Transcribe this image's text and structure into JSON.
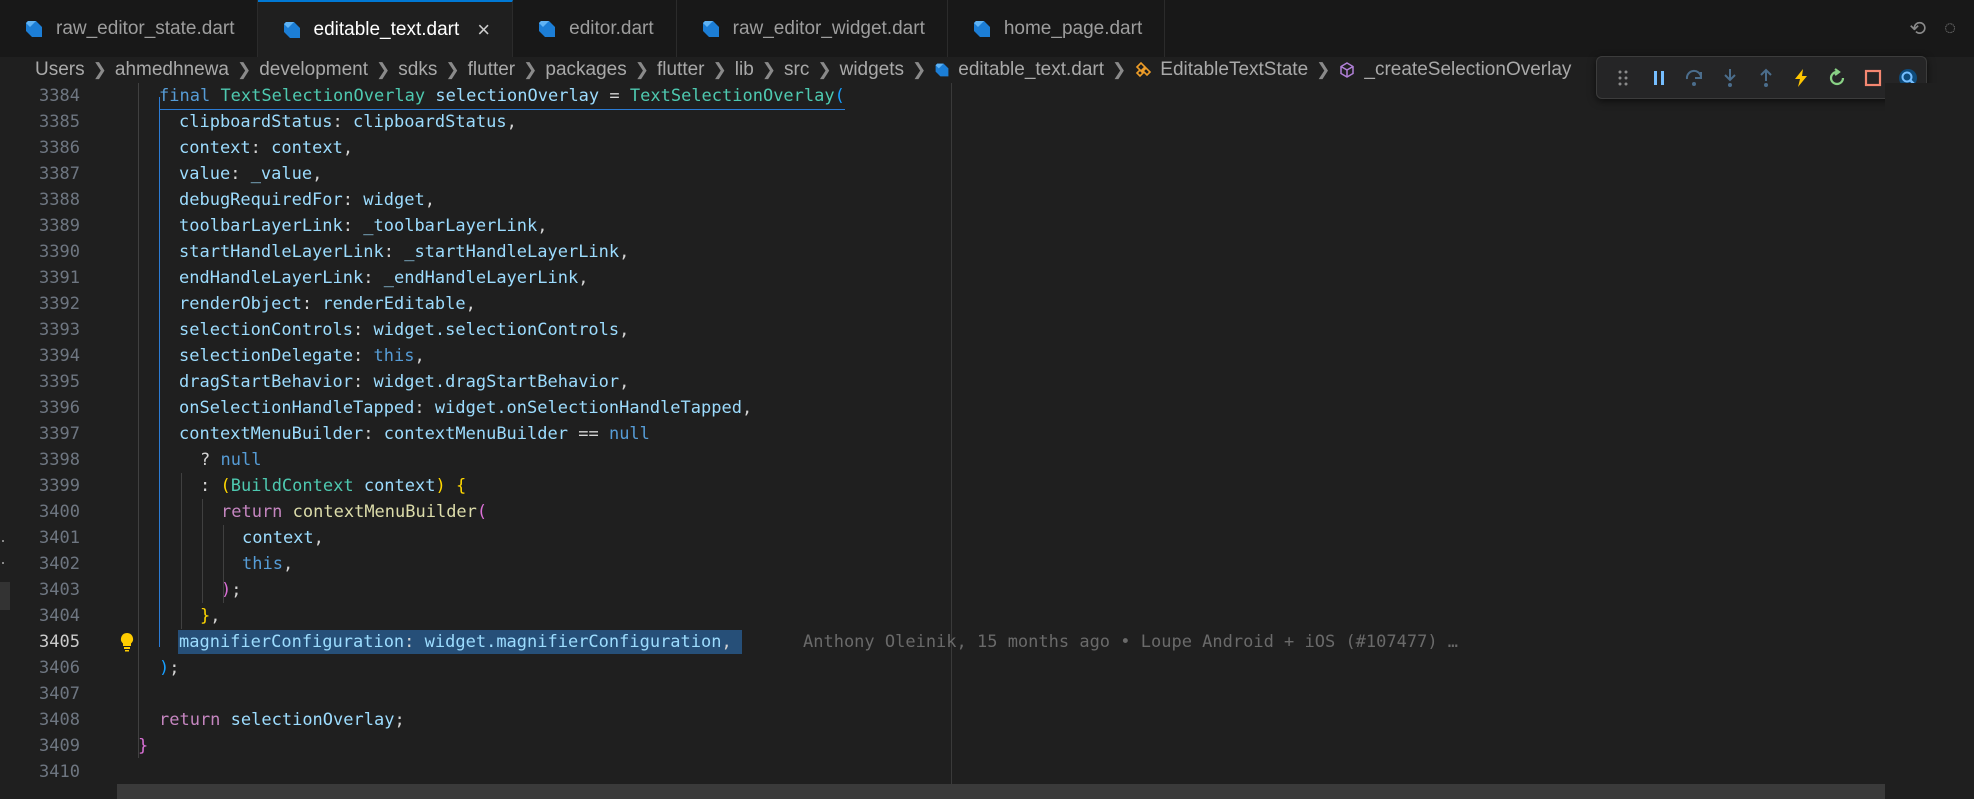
{
  "tabs": [
    {
      "label": "raw_editor_state.dart",
      "active": false
    },
    {
      "label": "editable_text.dart",
      "active": true
    },
    {
      "label": "editor.dart",
      "active": false
    },
    {
      "label": "raw_editor_widget.dart",
      "active": false
    },
    {
      "label": "home_page.dart",
      "active": false
    }
  ],
  "breadcrumb": [
    "Users",
    "ahmedhnewa",
    "development",
    "sdks",
    "flutter",
    "packages",
    "flutter",
    "lib",
    "src",
    "widgets",
    "editable_text.dart",
    "EditableTextState",
    "_createSelectionOverlay"
  ],
  "debug_toolbar": {
    "buttons": [
      "drag-handle",
      "pause",
      "step-over",
      "step-into",
      "step-out",
      "hot-reload",
      "restart",
      "stop",
      "inspect"
    ]
  },
  "editor": {
    "current_line": "3405",
    "blame": "Anthony Oleinik, 15 months ago • Loupe Android + iOS (#107477) …",
    "lines": [
      {
        "n": "3384"
      },
      {
        "n": "3385"
      },
      {
        "n": "3386"
      },
      {
        "n": "3387"
      },
      {
        "n": "3388"
      },
      {
        "n": "3389"
      },
      {
        "n": "3390"
      },
      {
        "n": "3391"
      },
      {
        "n": "3392"
      },
      {
        "n": "3393"
      },
      {
        "n": "3394"
      },
      {
        "n": "3395"
      },
      {
        "n": "3396"
      },
      {
        "n": "3397"
      },
      {
        "n": "3398"
      },
      {
        "n": "3399"
      },
      {
        "n": "3400"
      },
      {
        "n": "3401"
      },
      {
        "n": "3402"
      },
      {
        "n": "3403"
      },
      {
        "n": "3404"
      },
      {
        "n": "3405"
      },
      {
        "n": "3406"
      },
      {
        "n": "3407"
      },
      {
        "n": "3408"
      },
      {
        "n": "3409"
      },
      {
        "n": "3410"
      }
    ],
    "code": {
      "l3384": [
        "final",
        "TextSelectionOverlay",
        "selectionOverlay",
        "=",
        "TextSelectionOverlay",
        "("
      ],
      "l3385": [
        "clipboardStatus",
        ":",
        "clipboardStatus",
        ","
      ],
      "l3386": [
        "context",
        ":",
        "context",
        ","
      ],
      "l3387": [
        "value",
        ":",
        "_value",
        ","
      ],
      "l3388": [
        "debugRequiredFor",
        ":",
        "widget",
        ","
      ],
      "l3389": [
        "toolbarLayerLink",
        ":",
        "_toolbarLayerLink",
        ","
      ],
      "l3390": [
        "startHandleLayerLink",
        ":",
        "_startHandleLayerLink",
        ","
      ],
      "l3391": [
        "endHandleLayerLink",
        ":",
        "_endHandleLayerLink",
        ","
      ],
      "l3392": [
        "renderObject",
        ":",
        "renderEditable",
        ","
      ],
      "l3393": [
        "selectionControls",
        ":",
        "widget.selectionControls",
        ","
      ],
      "l3394": [
        "selectionDelegate",
        ":",
        "this",
        ","
      ],
      "l3395": [
        "dragStartBehavior",
        ":",
        "widget.dragStartBehavior",
        ","
      ],
      "l3396": [
        "onSelectionHandleTapped",
        ":",
        "widget.onSelectionHandleTapped",
        ","
      ],
      "l3397": [
        "contextMenuBuilder",
        ":",
        "contextMenuBuilder",
        "==",
        "null"
      ],
      "l3398": [
        "?",
        "null"
      ],
      "l3399": [
        ":",
        "(",
        "BuildContext",
        "context",
        ")",
        "{"
      ],
      "l3400": [
        "return",
        "contextMenuBuilder",
        "("
      ],
      "l3401": [
        "context",
        ","
      ],
      "l3402": [
        "this",
        ","
      ],
      "l3403": [
        ")",
        ";"
      ],
      "l3404": [
        "}",
        ","
      ],
      "l3405": [
        "magnifierConfiguration",
        ":",
        "widget.magnifierConfiguration",
        ","
      ],
      "l3406": [
        ")",
        ";"
      ],
      "l3408": [
        "return",
        "selectionOverlay",
        ";"
      ],
      "l3409": [
        "}"
      ]
    }
  }
}
